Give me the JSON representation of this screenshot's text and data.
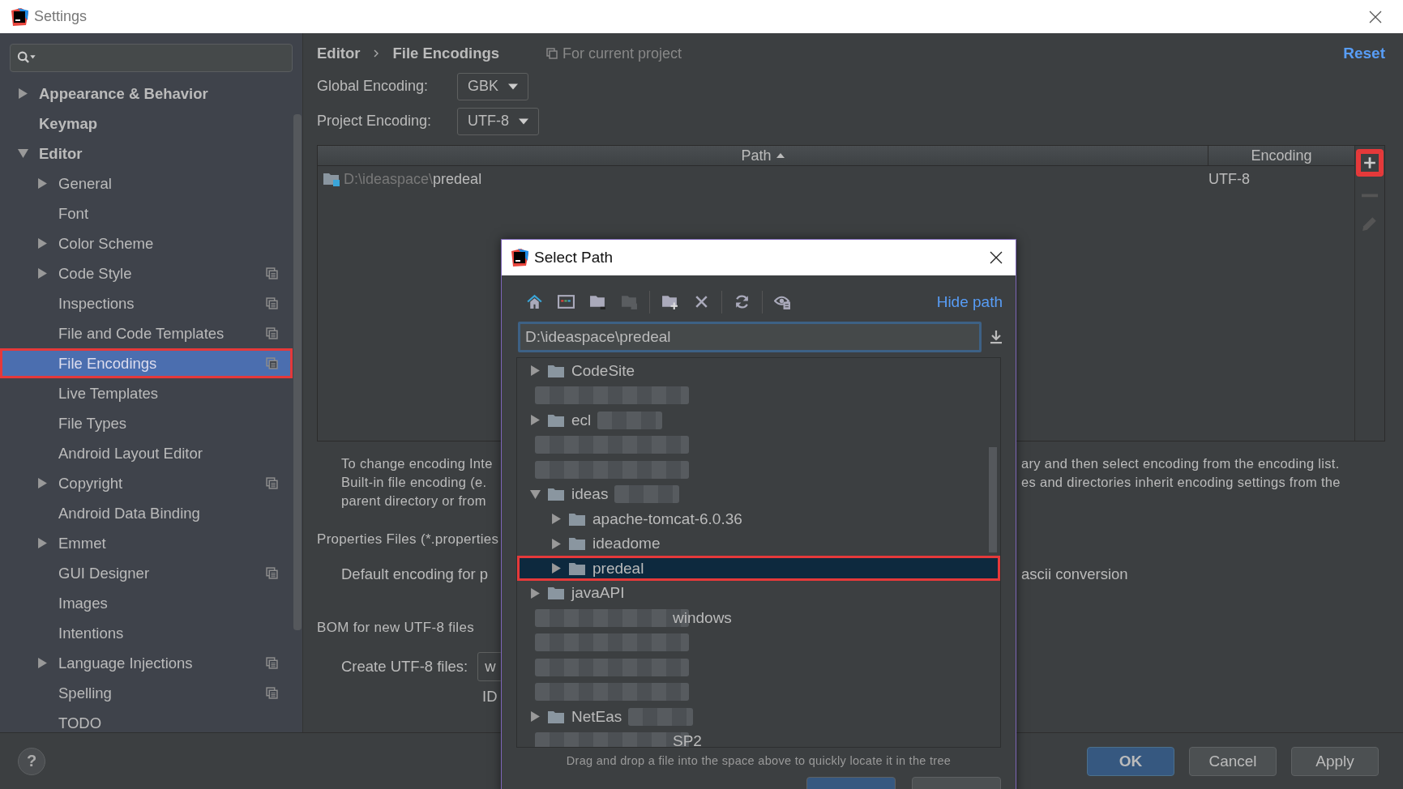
{
  "window": {
    "title": "Settings"
  },
  "sidebar": {
    "items": [
      {
        "label": "Appearance & Behavior",
        "expanded": false,
        "selected": false
      },
      {
        "label": "Keymap",
        "selected": false
      },
      {
        "label": "Editor",
        "expanded": true,
        "selected": false,
        "children": [
          {
            "label": "General",
            "expanded": false,
            "selected": false
          },
          {
            "label": "Font",
            "selected": false
          },
          {
            "label": "Color Scheme",
            "expanded": false,
            "selected": false
          },
          {
            "label": "Code Style",
            "expanded": false,
            "selected": false,
            "project_scoped": true
          },
          {
            "label": "Inspections",
            "selected": false,
            "project_scoped": true
          },
          {
            "label": "File and Code Templates",
            "selected": false,
            "project_scoped": true
          },
          {
            "label": "File Encodings",
            "selected": true,
            "project_scoped": true,
            "annotated": true
          },
          {
            "label": "Live Templates",
            "selected": false
          },
          {
            "label": "File Types",
            "selected": false
          },
          {
            "label": "Android Layout Editor",
            "selected": false
          },
          {
            "label": "Copyright",
            "expanded": false,
            "selected": false,
            "project_scoped": true
          },
          {
            "label": "Android Data Binding",
            "selected": false
          },
          {
            "label": "Emmet",
            "expanded": false,
            "selected": false
          },
          {
            "label": "GUI Designer",
            "selected": false,
            "project_scoped": true
          },
          {
            "label": "Images",
            "selected": false
          },
          {
            "label": "Intentions",
            "selected": false
          },
          {
            "label": "Language Injections",
            "expanded": false,
            "selected": false,
            "project_scoped": true
          },
          {
            "label": "Spelling",
            "selected": false,
            "project_scoped": true
          },
          {
            "label": "TODO",
            "selected": false
          }
        ]
      }
    ]
  },
  "breadcrumb": [
    "Editor",
    "File Encodings"
  ],
  "scope_note": "For current project",
  "reset_link": "Reset",
  "global_encoding": {
    "label": "Global Encoding:",
    "value": "GBK"
  },
  "project_encoding": {
    "label": "Project Encoding:",
    "value": "UTF-8"
  },
  "table": {
    "columns": [
      {
        "label": "Path",
        "sorted": true
      },
      {
        "label": "Encoding"
      }
    ],
    "rows": [
      {
        "dir": "D:\\ideaspace\\",
        "name": "predeal",
        "encoding": "UTF-8"
      }
    ],
    "tools": [
      {
        "kind": "add",
        "disabled": false,
        "annotated": true
      },
      {
        "kind": "remove",
        "disabled": true
      },
      {
        "kind": "edit",
        "disabled": true
      }
    ]
  },
  "description": {
    "left_lines": [
      "To change encoding Inte",
      "Built-in file encoding (e.",
      "parent directory or from"
    ],
    "right_lines": [
      "ary and then select encoding from the encoding list.",
      "es and directories inherit encoding settings from the"
    ]
  },
  "properties": {
    "heading": "Properties Files (*.properties",
    "default_label": "Default encoding for p",
    "conversion_label": "ascii conversion"
  },
  "bom": {
    "heading": "BOM for new UTF-8 files",
    "create_label": "Create UTF-8 files:",
    "create_value": "w",
    "note": "ID"
  },
  "dialog": {
    "title": "Select Path",
    "toolbar": [
      {
        "kind": "home",
        "disabled": false
      },
      {
        "kind": "desktop",
        "disabled": false
      },
      {
        "kind": "project",
        "disabled": false
      },
      {
        "kind": "module",
        "disabled": true
      },
      {
        "kind": "separator"
      },
      {
        "kind": "new-folder",
        "disabled": false
      },
      {
        "kind": "delete",
        "disabled": false
      },
      {
        "kind": "separator"
      },
      {
        "kind": "refresh",
        "disabled": false
      },
      {
        "kind": "separator"
      },
      {
        "kind": "hidden",
        "disabled": false
      }
    ],
    "hide_path_link": "Hide path",
    "path": "D:\\ideaspace\\predeal",
    "tree": [
      {
        "kind": "folder",
        "label": "CodeSite",
        "expanded": false,
        "selected": false
      },
      {
        "kind": "redacted"
      },
      {
        "kind": "folder",
        "label": "ecl",
        "expanded": false,
        "selected": false,
        "blurred": true
      },
      {
        "kind": "redacted"
      },
      {
        "kind": "redacted"
      },
      {
        "kind": "folder",
        "label": "ideas",
        "expanded": true,
        "selected": false,
        "blurred": true,
        "children": [
          {
            "kind": "folder",
            "label": "apache-tomcat-6.0.36",
            "expanded": false,
            "selected": false
          },
          {
            "kind": "folder",
            "label": "ideadome",
            "expanded": false,
            "selected": false
          },
          {
            "kind": "folder",
            "label": "predeal",
            "expanded": false,
            "selected": true,
            "annotated": true
          }
        ]
      },
      {
        "kind": "folder",
        "label": "javaAPI",
        "expanded": false,
        "selected": false
      },
      {
        "kind": "partial",
        "label": "windows"
      },
      {
        "kind": "redacted"
      },
      {
        "kind": "redacted"
      },
      {
        "kind": "redacted"
      },
      {
        "kind": "folder",
        "label": "NetEas",
        "expanded": false,
        "selected": false,
        "blurred": true
      },
      {
        "kind": "partial",
        "label": "SP2"
      }
    ],
    "hint": "Drag and drop a file into the space above to quickly locate it in the tree"
  },
  "footer": {
    "help": "?",
    "buttons": [
      {
        "label": "OK",
        "default": true
      },
      {
        "label": "Cancel",
        "default": false
      },
      {
        "label": "Apply",
        "default": false
      }
    ]
  }
}
